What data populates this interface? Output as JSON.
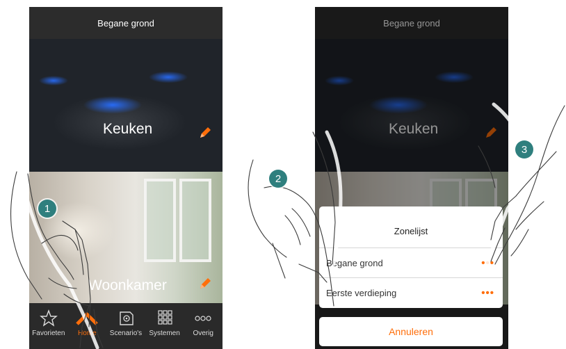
{
  "left_screen": {
    "header_title": "Begane grond",
    "rooms": [
      {
        "label": "Keuken"
      },
      {
        "label": "Woonkamer"
      }
    ],
    "tabs": [
      {
        "label": "Favorieten",
        "icon": "star-icon",
        "active": false
      },
      {
        "label": "Home",
        "icon": "home-chevron-icon",
        "active": true
      },
      {
        "label": "Scenario's",
        "icon": "scenario-icon",
        "active": false
      },
      {
        "label": "Systemen",
        "icon": "grid-icon",
        "active": false
      },
      {
        "label": "Overig",
        "icon": "more-dots-icon",
        "active": false
      }
    ]
  },
  "right_screen": {
    "header_title": "Begane grond",
    "rooms": [
      {
        "label": "Keuken"
      }
    ],
    "zone_list": {
      "title": "Zonelijst",
      "items": [
        {
          "label": "Begane grond",
          "more": "•••"
        },
        {
          "label": "Eerste verdieping",
          "more": "•••"
        }
      ],
      "cancel_label": "Annuleren"
    }
  },
  "steps": [
    "1",
    "2",
    "3"
  ],
  "colors": {
    "accent": "#ff6e0a",
    "header_bg": "#2c2c2c",
    "step_badge": "#2f7f7e"
  }
}
